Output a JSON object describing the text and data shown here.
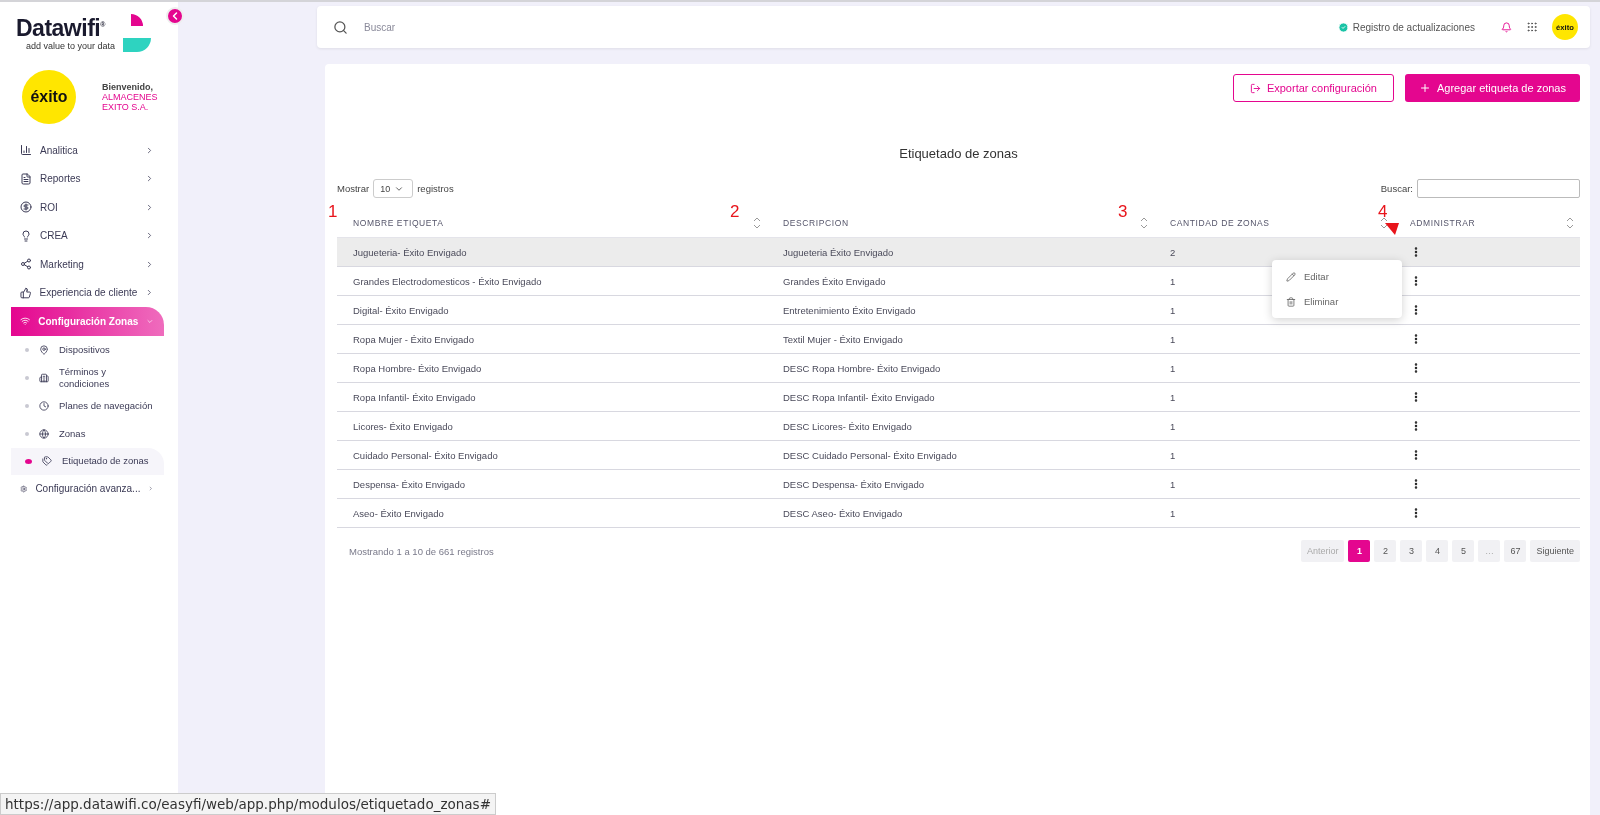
{
  "sidebar": {
    "brand": "Datawifi",
    "brand_mark": "®",
    "tagline": "add value to your data",
    "avatar_text": "éxito",
    "welcome": "Bienvenido,",
    "company": "ALMACENES EXITO S.A.",
    "items": [
      {
        "label": "Analitica",
        "selected": false,
        "expanded": false
      },
      {
        "label": "Reportes",
        "selected": false,
        "expanded": false
      },
      {
        "label": "ROI",
        "selected": false,
        "expanded": false
      },
      {
        "label": "CREA",
        "selected": false,
        "expanded": false
      },
      {
        "label": "Marketing",
        "selected": false,
        "expanded": false
      },
      {
        "label": "Experiencia de cliente",
        "selected": false,
        "expanded": false
      },
      {
        "label": "Configuración Zonas",
        "selected": true,
        "expanded": true,
        "children": [
          {
            "label": "Dispositivos",
            "selected": false
          },
          {
            "label": "Términos y condiciones",
            "selected": false
          },
          {
            "label": "Planes de navegación",
            "selected": false
          },
          {
            "label": "Zonas",
            "selected": false
          },
          {
            "label": "Etiquetado de zonas",
            "selected": true
          }
        ]
      },
      {
        "label": "Configuración avanza...",
        "selected": false,
        "expanded": false
      }
    ]
  },
  "header": {
    "search": {
      "placeholder": "Buscar"
    },
    "updates": "Registro de actualizaciones",
    "avatar_text": "éxito"
  },
  "actions": {
    "export": "Exportar configuración",
    "add": "Agregar etiqueta de zonas"
  },
  "title": "Etiquetado de zonas",
  "length": {
    "before": "Mostrar",
    "value": "10",
    "after": "registros"
  },
  "filter": {
    "label": "Buscar:"
  },
  "table": {
    "columns": [
      "NOMBRE ETIQUETA",
      "DESCRIPCION",
      "CANTIDAD DE ZONAS",
      "ADMINISTRAR"
    ],
    "rows": [
      {
        "name": "Jugueteria- Éxito Envigado",
        "description": "Jugueteria Éxito Envigado",
        "count": "2",
        "selected": true,
        "menu": [
          {
            "kind": "edit",
            "label": "Editar"
          },
          {
            "kind": "delete",
            "label": "Eliminar"
          }
        ]
      },
      {
        "name": "Grandes Electrodomesticos - Éxito Envigado",
        "description": "Grandes Éxito Envigado",
        "count": "1",
        "selected": false
      },
      {
        "name": "Digital- Éxito Envigado",
        "description": "Entretenimiento Éxito Envigado",
        "count": "1",
        "selected": false
      },
      {
        "name": "Ropa Mujer - Éxito Envigado",
        "description": "Textil Mujer - Éxito Envigado",
        "count": "1",
        "selected": false
      },
      {
        "name": "Ropa Hombre- Éxito Envigado",
        "description": "DESC Ropa Hombre- Éxito Envigado",
        "count": "1",
        "selected": false
      },
      {
        "name": "Ropa Infantil- Éxito Envigado",
        "description": "DESC Ropa Infantil- Éxito Envigado",
        "count": "1",
        "selected": false
      },
      {
        "name": "Licores- Éxito Envigado",
        "description": "DESC Licores- Éxito Envigado",
        "count": "1",
        "selected": false
      },
      {
        "name": "Cuidado Personal- Éxito Envigado",
        "description": "DESC Cuidado Personal- Éxito Envigado",
        "count": "1",
        "selected": false
      },
      {
        "name": "Despensa- Éxito Envigado",
        "description": "DESC Despensa- Éxito Envigado",
        "count": "1",
        "selected": false
      },
      {
        "name": "Aseo- Éxito Envigado",
        "description": "DESC Aseo- Éxito Envigado",
        "count": "1",
        "selected": false
      }
    ],
    "markers": [
      "1",
      "2",
      "3",
      "4"
    ]
  },
  "info": "Mostrando 1 a 10 de 661 registros",
  "pagination": [
    {
      "label": "Anterior",
      "selected": false,
      "disabled": true
    },
    {
      "label": "1",
      "selected": true,
      "disabled": false
    },
    {
      "label": "2",
      "selected": false,
      "disabled": false
    },
    {
      "label": "3",
      "selected": false,
      "disabled": false
    },
    {
      "label": "4",
      "selected": false,
      "disabled": false
    },
    {
      "label": "5",
      "selected": false,
      "disabled": false
    },
    {
      "label": "…",
      "selected": false,
      "disabled": true
    },
    {
      "label": "67",
      "selected": false,
      "disabled": false
    },
    {
      "label": "Siguiente",
      "selected": false,
      "disabled": false
    }
  ],
  "status_url": "https://app.datawifi.co/easyfi/web/app.php/modulos/etiquetado_zonas#"
}
